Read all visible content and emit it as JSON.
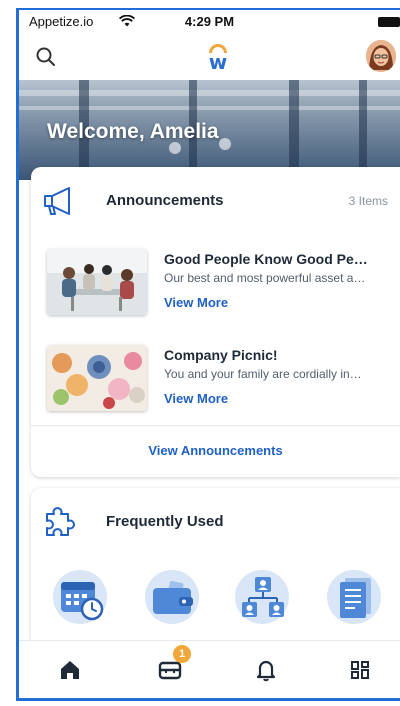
{
  "status_bar": {
    "carrier": "Appetize.io",
    "time": "4:29 PM"
  },
  "header": {
    "logo_letter": "w"
  },
  "hero": {
    "welcome": "Welcome, Amelia"
  },
  "announcements": {
    "title": "Announcements",
    "count": "3 Items",
    "items": [
      {
        "title": "Good People Know Good Pe…",
        "desc": "Our best and most powerful asset a…",
        "link": "View More"
      },
      {
        "title": "Company Picnic!",
        "desc": "You and your family are cordially in…",
        "link": "View More"
      }
    ],
    "view_all": "View Announcements"
  },
  "frequently_used": {
    "title": "Frequently Used",
    "tiles": [
      "calendar-clock-icon",
      "wallet-icon",
      "org-chart-icon",
      "document-icon"
    ]
  },
  "bottom_nav": {
    "badge": "1",
    "items": [
      "home-icon",
      "inbox-icon",
      "bell-icon",
      "apps-grid-icon"
    ]
  },
  "colors": {
    "accent_blue": "#2061c4",
    "brand_orange": "#f2a73b",
    "tile_bg": "#d9e6f7"
  }
}
